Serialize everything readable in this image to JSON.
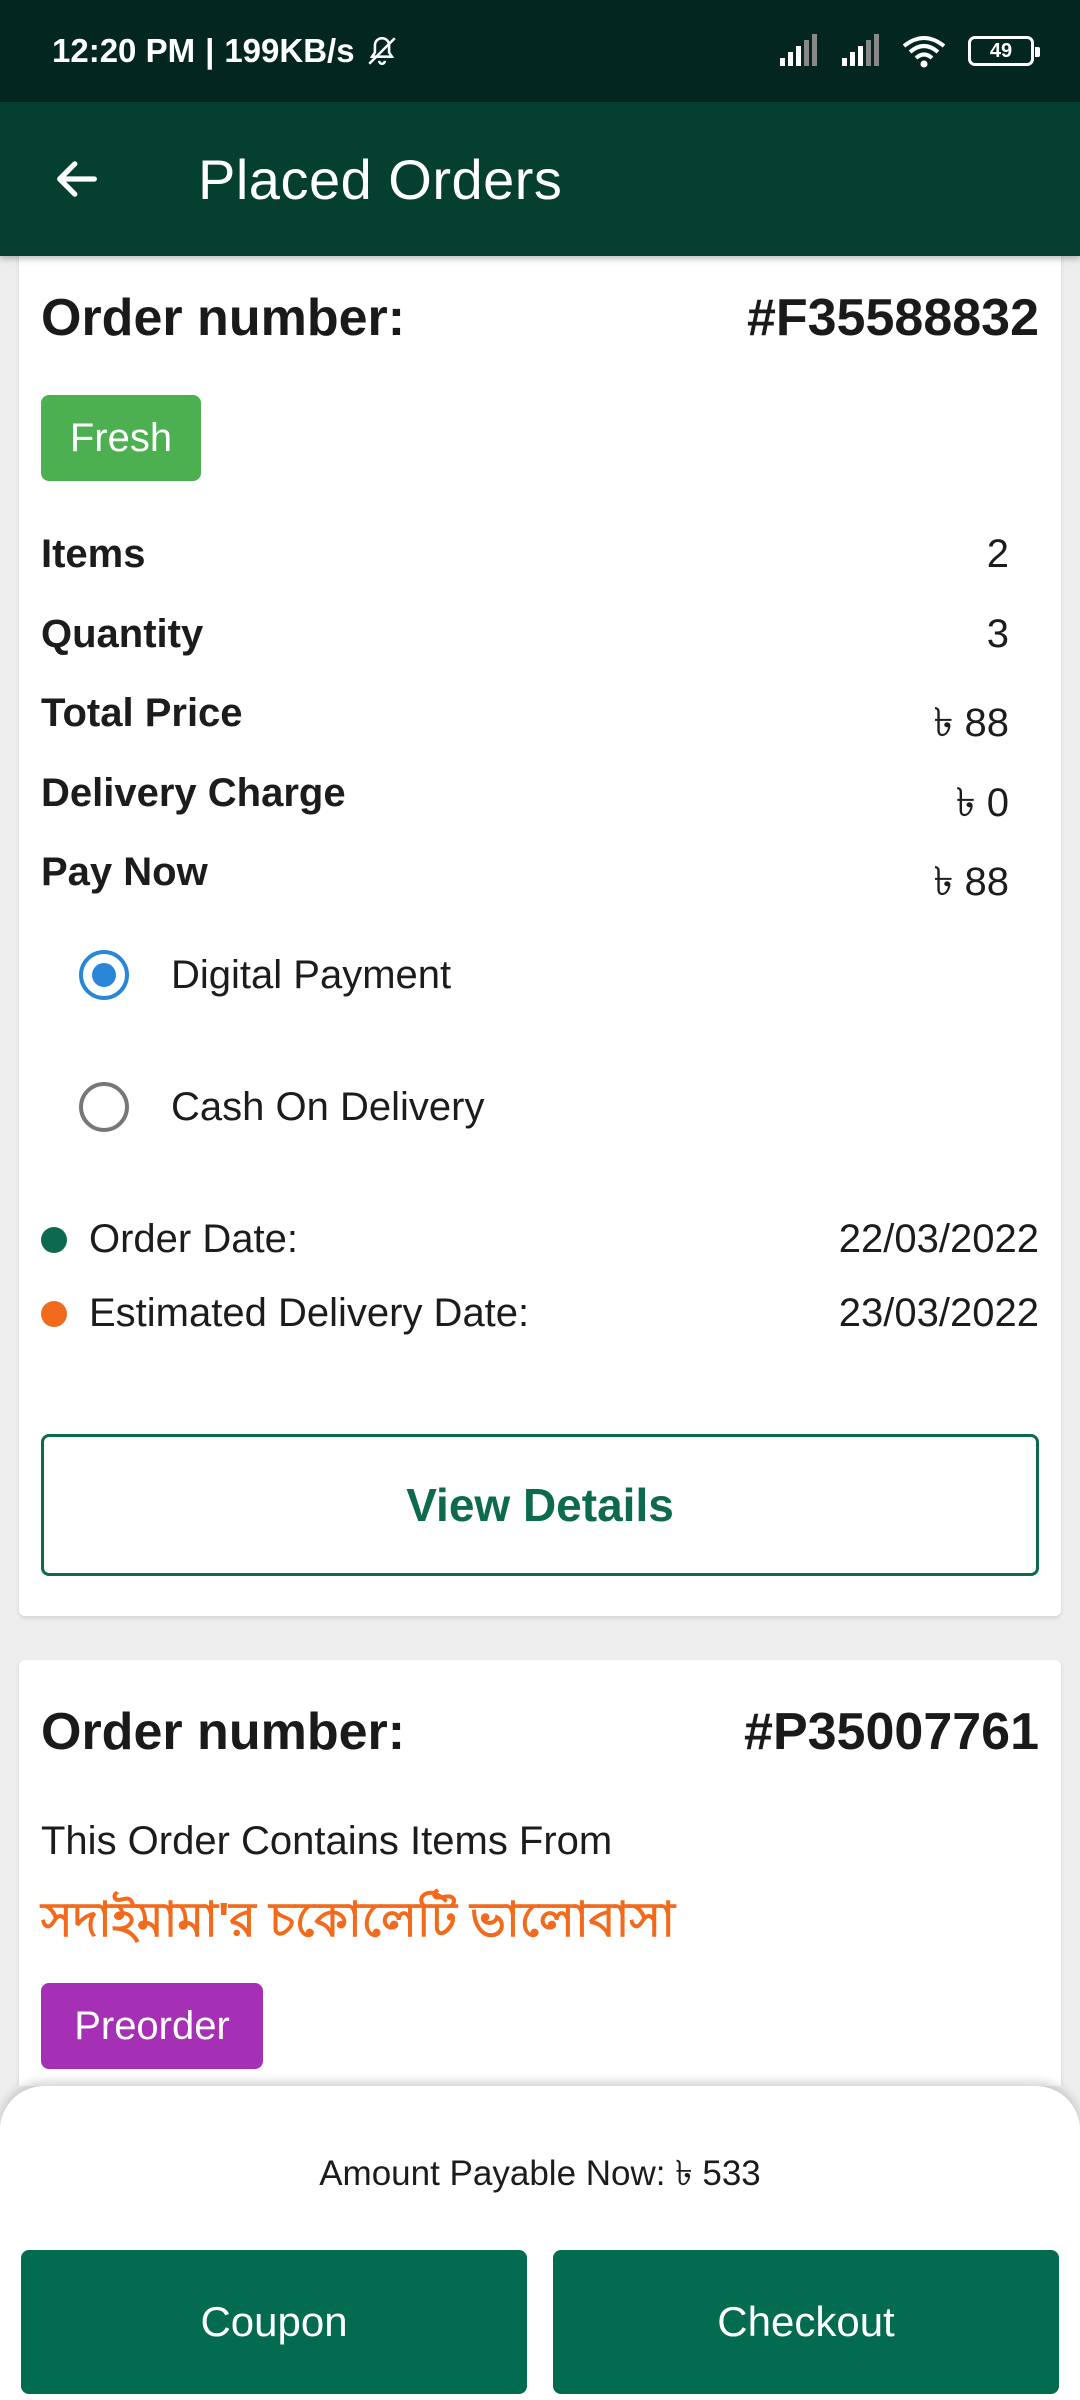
{
  "status_bar": {
    "time": "12:20 PM",
    "speed": "199KB/s",
    "battery": "49",
    "icons": [
      "bell-off-icon",
      "signal-icon",
      "signal-icon",
      "wifi-icon",
      "battery-icon"
    ]
  },
  "app_bar": {
    "title": "Placed Orders",
    "back_icon": "arrow-left-icon"
  },
  "orders": [
    {
      "label": "Order number:",
      "number": "#F35588832",
      "badge": "Fresh",
      "badge_color": "#4cb050",
      "summary": [
        {
          "label": "Items",
          "value": "2"
        },
        {
          "label": "Quantity",
          "value": "3"
        },
        {
          "label": "Total Price",
          "value": "৳ 88"
        },
        {
          "label": "Delivery Charge",
          "value": "৳ 0"
        },
        {
          "label": "Pay Now",
          "value": "৳ 88"
        }
      ],
      "payment_options": [
        {
          "label": "Digital Payment",
          "selected": true
        },
        {
          "label": "Cash On Delivery",
          "selected": false
        }
      ],
      "order_date_label": "Order Date:",
      "order_date": "22/03/2022",
      "delivery_date_label": "Estimated Delivery Date:",
      "delivery_date": "23/03/2022",
      "view_details": "View Details"
    },
    {
      "label": "Order number:",
      "number": "#P35007761",
      "contains_text": "This Order Contains Items From",
      "shop_name": "সদাইমামা'র চকোলেটি ভালোবাসা",
      "badge": "Preorder",
      "badge_color": "#a52fb5"
    }
  ],
  "bottom_sheet": {
    "amount_payable": "Amount Payable Now: ৳ 533",
    "coupon": "Coupon",
    "checkout": "Checkout"
  },
  "colors": {
    "status_bar": "#032620",
    "app_bar": "#053f30",
    "primary": "#036b4f",
    "radio_selected": "#2a87d8",
    "order_date_dot": "#0d6a4f",
    "delivery_date_dot": "#f26a1b",
    "shop_name": "#f26a1b"
  }
}
